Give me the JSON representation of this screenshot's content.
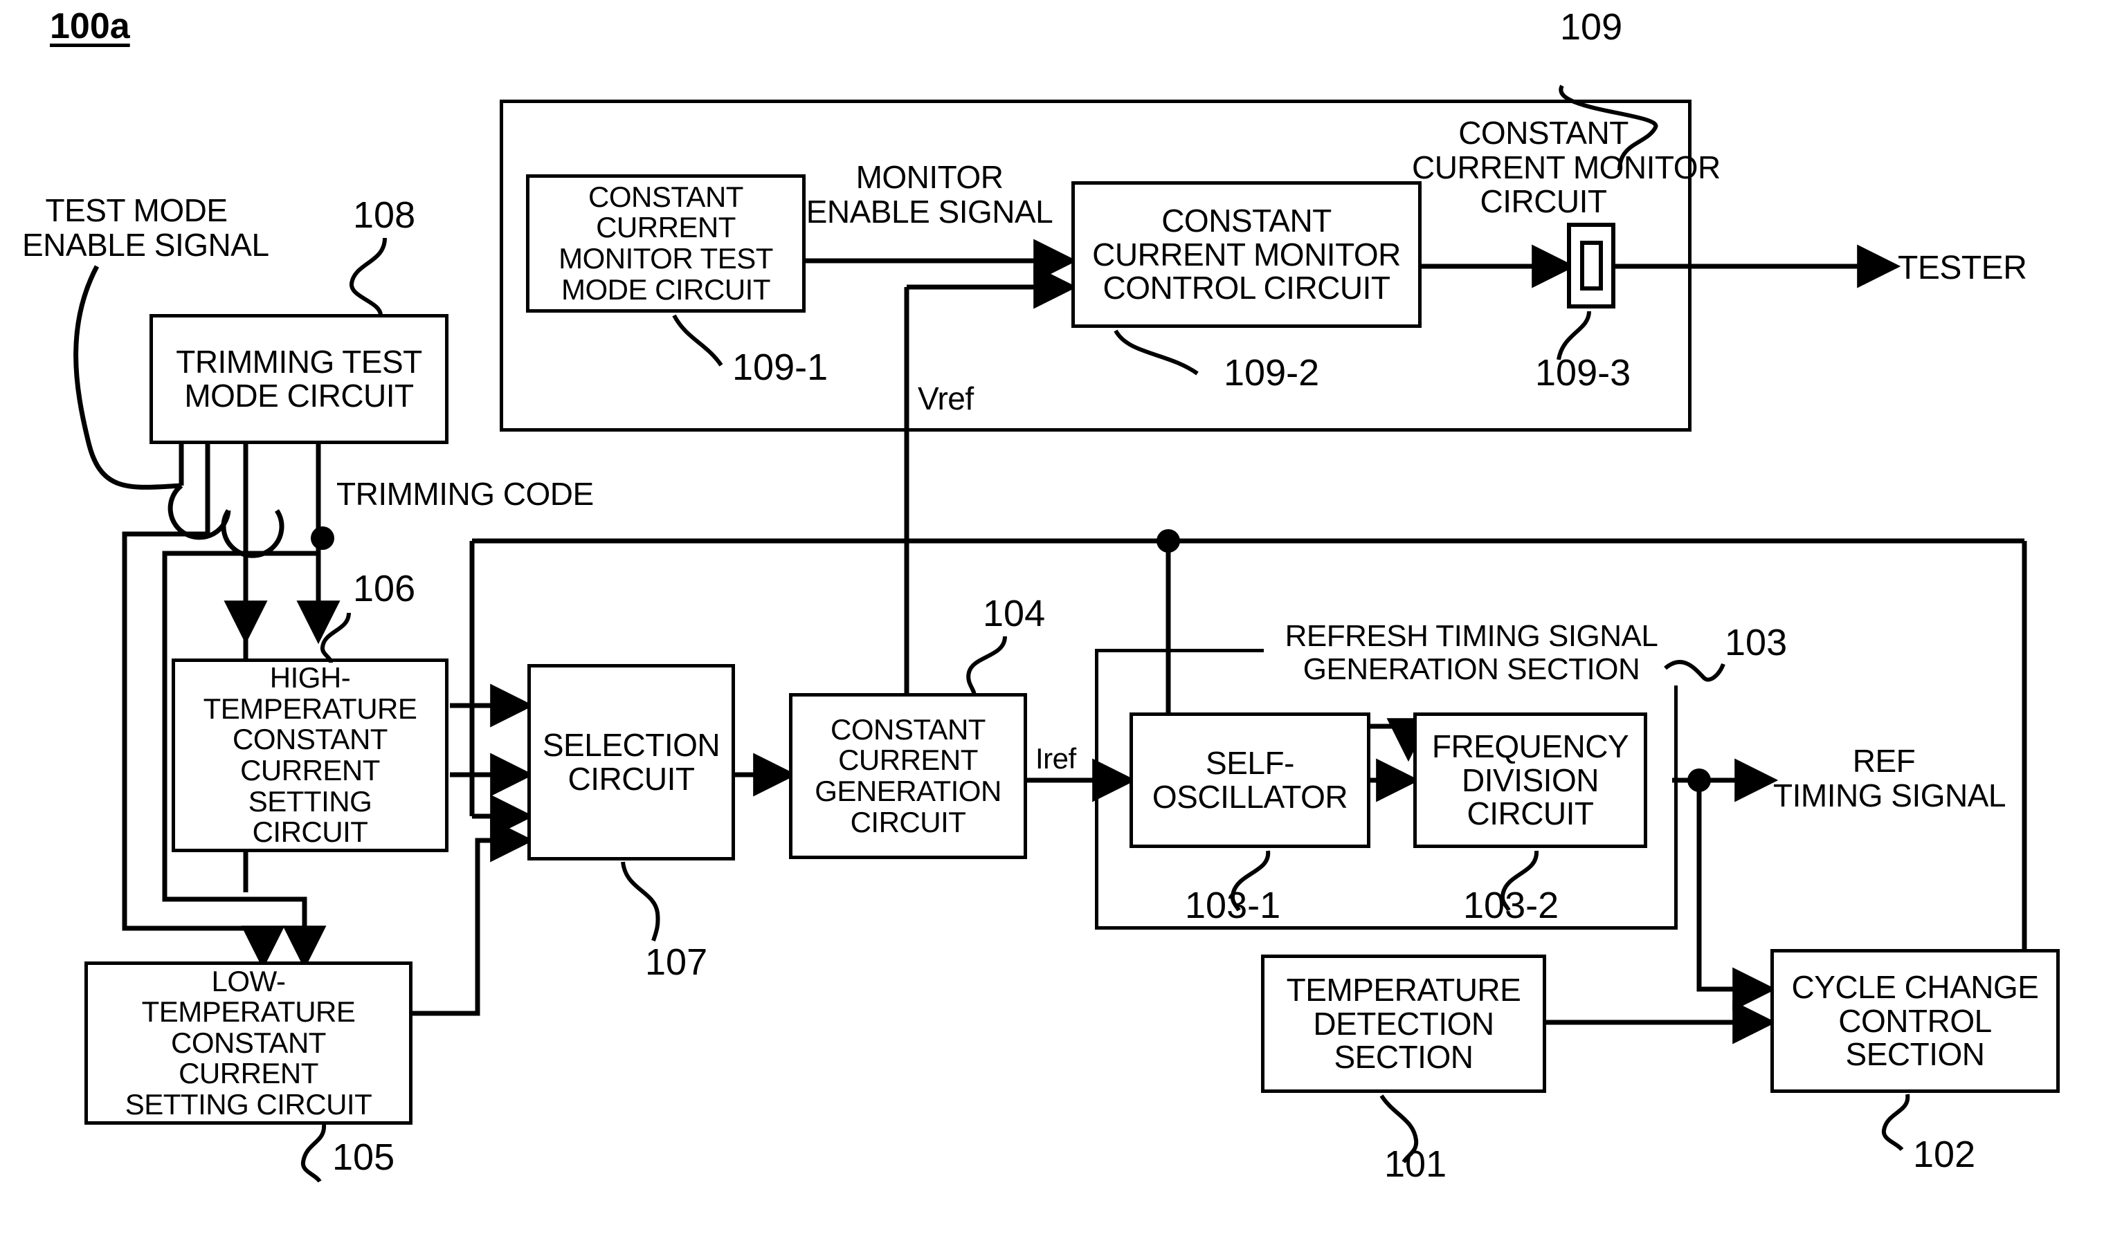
{
  "figure": {
    "id_label": "100a"
  },
  "blocks": {
    "trimming_test_mode": {
      "label": "TRIMMING TEST\nMODE CIRCUIT",
      "ref": "108"
    },
    "high_temp_setting": {
      "label": "HIGH-\nTEMPERATURE\nCONSTANT\nCURRENT\nSETTING\nCIRCUIT",
      "ref": "106"
    },
    "low_temp_setting": {
      "label": "LOW-\nTEMPERATURE\nCONSTANT\nCURRENT\nSETTING CIRCUIT",
      "ref": "105"
    },
    "selection": {
      "label": "SELECTION\nCIRCUIT",
      "ref": "107"
    },
    "constant_current_gen": {
      "label": "CONSTANT\nCURRENT\nGENERATION\nCIRCUIT",
      "ref": "104"
    },
    "self_oscillator": {
      "label": "SELF-\nOSCILLATOR",
      "ref": "103-1"
    },
    "frequency_division": {
      "label": "FREQUENCY\nDIVISION\nCIRCUIT",
      "ref": "103-2"
    },
    "refresh_timing_section": {
      "label": "REFRESH TIMING SIGNAL\nGENERATION SECTION",
      "ref": "103"
    },
    "temperature_detection": {
      "label": "TEMPERATURE\nDETECTION\nSECTION",
      "ref": "101"
    },
    "cycle_change_control": {
      "label": "CYCLE CHANGE\nCONTROL\nSECTION",
      "ref": "102"
    },
    "cc_monitor_group": {
      "label": "CONSTANT\nCURRENT MONITOR\nCIRCUIT",
      "ref": "109"
    },
    "cc_monitor_test_mode": {
      "label": "CONSTANT\nCURRENT\nMONITOR TEST\nMODE CIRCUIT",
      "ref": "109-1"
    },
    "cc_monitor_control": {
      "label": "CONSTANT\nCURRENT MONITOR\nCONTROL CIRCUIT",
      "ref": "109-2"
    },
    "monitor_pad": {
      "label": "",
      "ref": "109-3"
    }
  },
  "signals": {
    "test_mode_enable": "TEST MODE\nENABLE SIGNAL",
    "trimming_code": "TRIMMING CODE",
    "monitor_enable": "MONITOR\nENABLE SIGNAL",
    "vref": "Vref",
    "iref": "Iref",
    "tester": "TESTER",
    "ref_timing_signal": "REF\nTIMING SIGNAL"
  },
  "colors": {
    "line": "#000000",
    "background": "#ffffff"
  }
}
